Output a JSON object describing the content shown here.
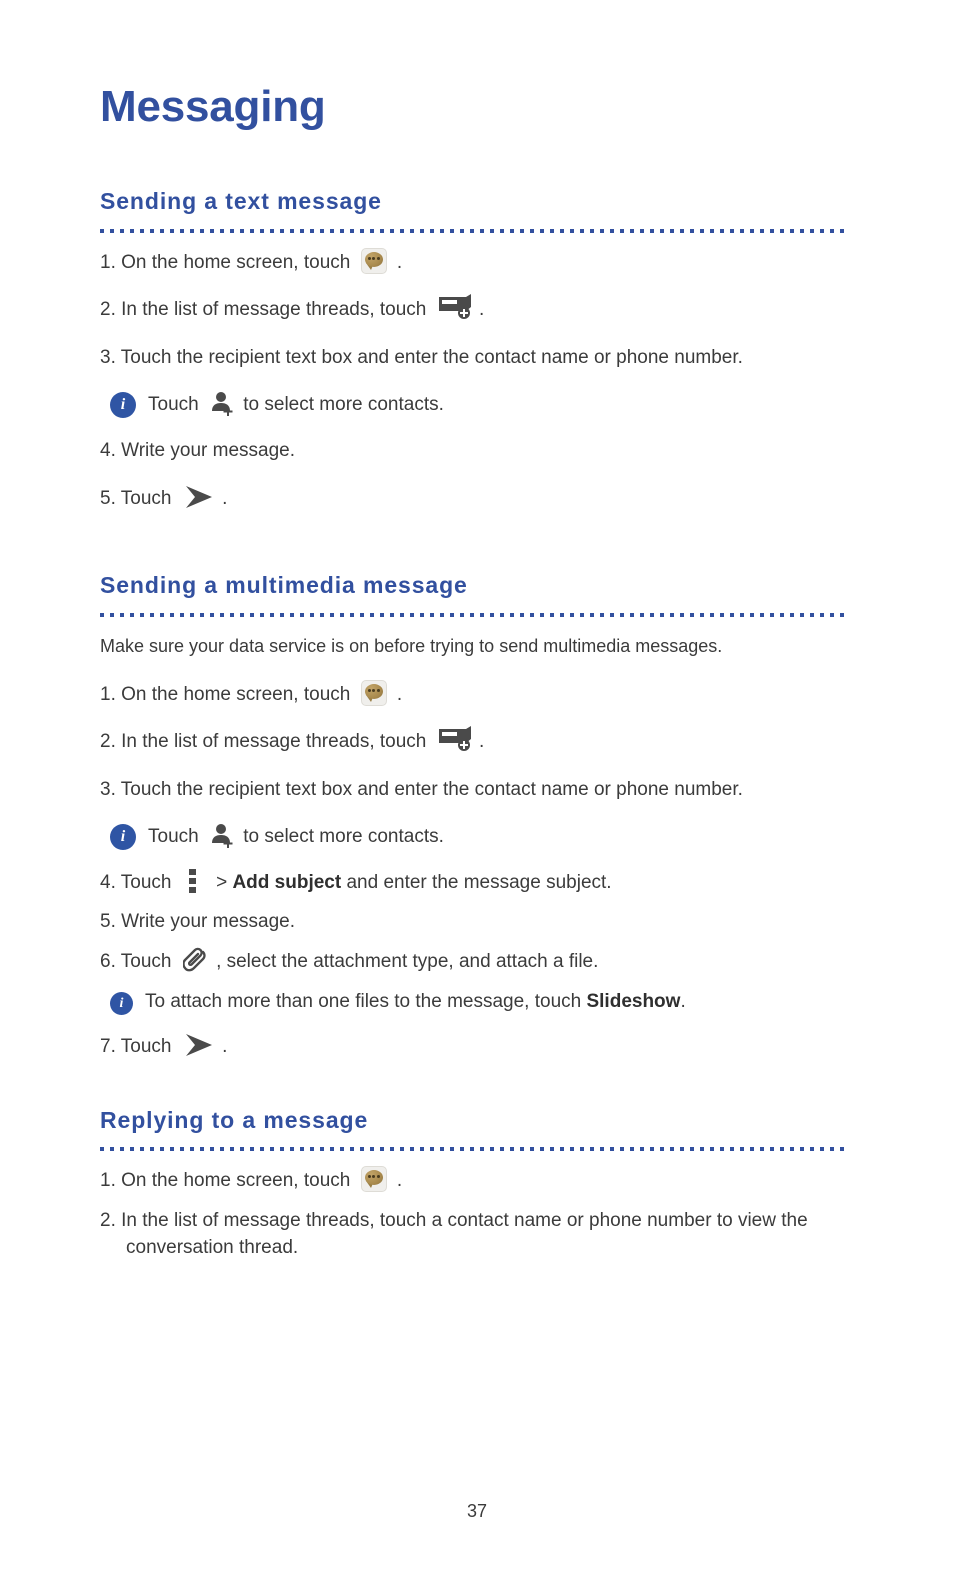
{
  "document": {
    "title": "Messaging",
    "page_number": "37",
    "accent_color": "#32509f",
    "body_color": "#3b3b3b"
  },
  "sections": [
    {
      "heading": "Sending a text message",
      "intro": null,
      "steps": [
        {
          "type": "step",
          "number": "1.",
          "before": "On the home screen, touch",
          "icon": "messaging-app-icon",
          "after": "."
        },
        {
          "type": "step",
          "number": "2.",
          "before": "In the list of message threads, touch",
          "icon": "new-message-icon",
          "after": "."
        },
        {
          "type": "step",
          "number": "3.",
          "before": "Touch the recipient text box and enter the contact name or phone number.",
          "icon": null,
          "after": ""
        },
        {
          "type": "note",
          "icon": "info-icon",
          "before": "Touch",
          "inline_icon": "add-contact-icon",
          "after": "to select more contacts."
        },
        {
          "type": "step",
          "number": "4.",
          "before": "Write your message.",
          "icon": null,
          "after": ""
        },
        {
          "type": "step",
          "number": "5.",
          "before": "Touch",
          "icon": "send-icon",
          "after": "."
        }
      ]
    },
    {
      "heading": "Sending a multimedia message",
      "intro": "Make sure your data service is on before trying to send multimedia messages.",
      "steps": [
        {
          "type": "step",
          "number": "1.",
          "before": "On the home screen, touch",
          "icon": "messaging-app-icon",
          "after": "."
        },
        {
          "type": "step",
          "number": "2.",
          "before": "In the list of message threads, touch",
          "icon": "new-message-icon",
          "after": "."
        },
        {
          "type": "step",
          "number": "3.",
          "before": "Touch the recipient text box and enter the contact name or phone number.",
          "icon": null,
          "after": ""
        },
        {
          "type": "note",
          "icon": "info-icon",
          "before": "Touch",
          "inline_icon": "add-contact-icon",
          "after": "to select more contacts."
        },
        {
          "type": "step",
          "number": "4.",
          "before": "Touch",
          "icon": "overflow-menu-icon",
          "separator": ">",
          "bold": "Add subject",
          "after": "and enter the message subject."
        },
        {
          "type": "step",
          "number": "5.",
          "before": "Write your message.",
          "icon": null,
          "after": ""
        },
        {
          "type": "step",
          "number": "6.",
          "before": "Touch",
          "icon": "paperclip-icon",
          "after": ", select the attachment type, and attach a file."
        },
        {
          "type": "note",
          "icon": "info-icon",
          "before": "To attach more than one files to the message, touch",
          "bold": "Slideshow",
          "after": "."
        },
        {
          "type": "step",
          "number": "7.",
          "before": "Touch",
          "icon": "send-icon",
          "after": "."
        }
      ]
    },
    {
      "heading": "Replying to a message",
      "intro": null,
      "steps": [
        {
          "type": "step",
          "number": "1.",
          "before": "On the home screen, touch",
          "icon": "messaging-app-icon",
          "after": "."
        },
        {
          "type": "step",
          "number": "2.",
          "before": "In the list of message threads, touch a contact name or phone number to view the conversation thread.",
          "icon": null,
          "after": ""
        }
      ]
    }
  ]
}
